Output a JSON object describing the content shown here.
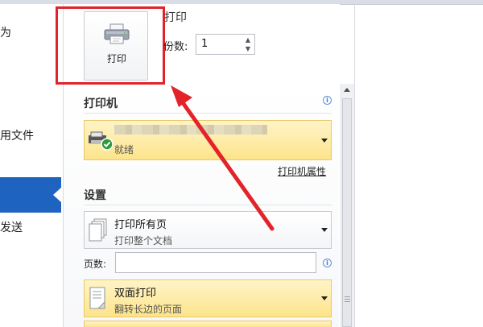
{
  "nav": {
    "items": [
      "为",
      "用文件",
      "发送"
    ]
  },
  "print": {
    "button_label": "打印",
    "title": "打印",
    "copies_label": "份数:",
    "copies_value": "1"
  },
  "printer": {
    "heading": "打印机",
    "status": "就绪",
    "properties_link": "打印机属性"
  },
  "settings": {
    "heading": "设置",
    "range_title": "打印所有页",
    "range_sub": "打印整个文档",
    "pages_label": "页数:",
    "duplex_title": "双面打印",
    "duplex_sub": "翻转长边的页面"
  },
  "colors": {
    "accent_nav": "#1f63c1",
    "callout_red": "#e3232a",
    "highlight_yellow": "#fde48b"
  },
  "icons": [
    "printer-icon",
    "info-icon",
    "dropdown-arrow-icon",
    "spin-up-icon",
    "spin-down-icon",
    "status-ok-icon",
    "pages-stack-icon",
    "duplex-icon"
  ]
}
